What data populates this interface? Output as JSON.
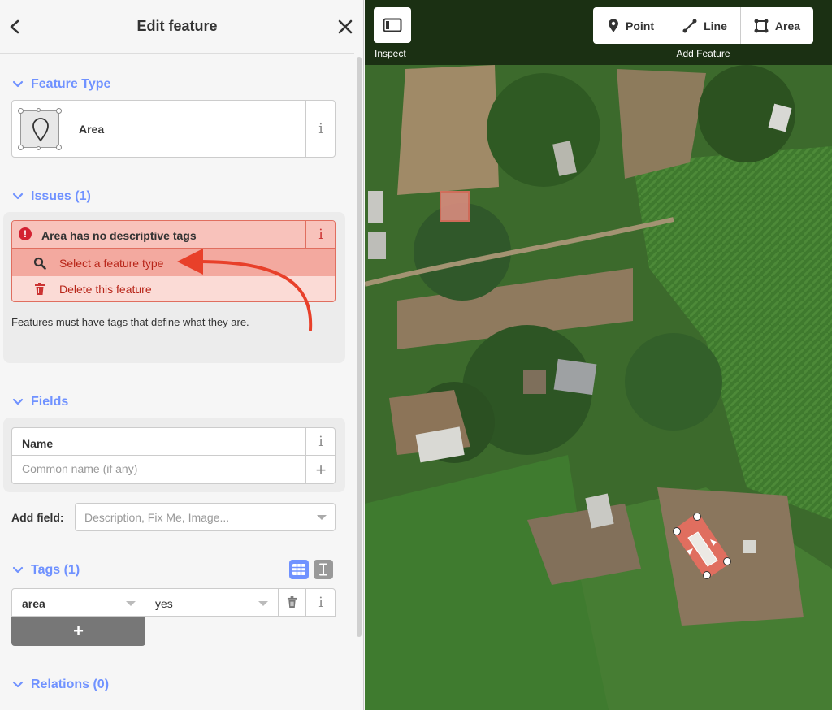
{
  "sidebar": {
    "header": {
      "title": "Edit feature"
    },
    "feature_type": {
      "section_label": "Feature Type",
      "preset_name": "Area",
      "info_glyph": "i"
    },
    "issues": {
      "section_label": "Issues (1)",
      "issue_title": "Area has no descriptive tags",
      "error_glyph": "!",
      "info_glyph": "i",
      "fixes": [
        {
          "label": "Select a feature type",
          "icon": "search-icon"
        },
        {
          "label": "Delete this feature",
          "icon": "trash-icon"
        }
      ],
      "tip": "Features must have tags that define what they are."
    },
    "fields": {
      "section_label": "Fields",
      "name_field": {
        "label": "Name",
        "placeholder": "Common name (if any)",
        "value": "",
        "info_glyph": "i",
        "add_glyph": "+"
      },
      "add_field": {
        "label": "Add field:",
        "placeholder": "Description, Fix Me, Image..."
      }
    },
    "tags": {
      "section_label": "Tags (1)",
      "rows": [
        {
          "key": "area",
          "value": "yes"
        }
      ],
      "info_glyph": "i",
      "add_glyph": "+"
    },
    "relations": {
      "section_label": "Relations (0)"
    }
  },
  "map": {
    "inspect_label": "Inspect",
    "add_feature_label": "Add Feature",
    "modes": [
      {
        "label": "Point",
        "icon": "point-icon"
      },
      {
        "label": "Line",
        "icon": "line-icon"
      },
      {
        "label": "Area",
        "icon": "area-icon"
      }
    ]
  },
  "colors": {
    "accent": "#7092ff",
    "error": "#d32232",
    "selection": "#e06e5f",
    "arrow": "#e8402a"
  }
}
